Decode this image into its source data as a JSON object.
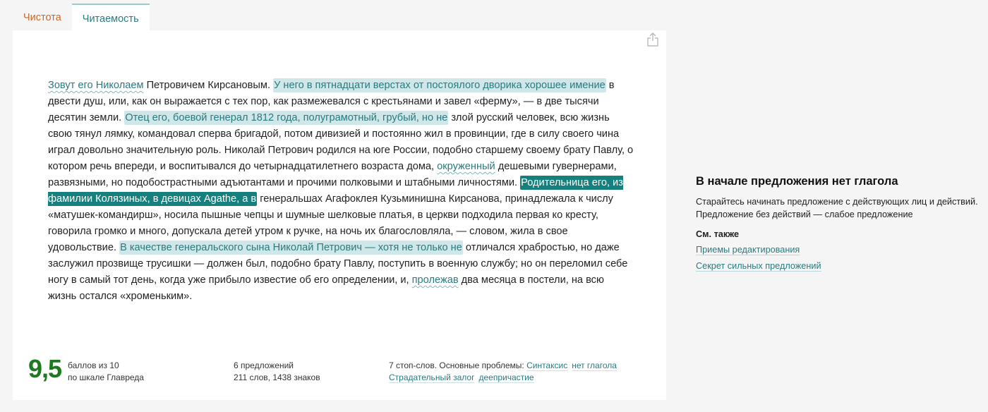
{
  "tabs": [
    {
      "label": "Чистота"
    },
    {
      "label": "Читаемость"
    }
  ],
  "text_segments": [
    "Зовут его Николаем",
    " Петровичем Кирсановым. ",
    "У него в пятнадцати верстах от постоялого дворика хорошее имение",
    " в двести душ, или, как он выражается с тех пор, как размежевался с крестьянами и завел «ферму», — в две тысячи десятин земли. ",
    "Отец его, боевой генерал 1812 года, полуграмотный, грубый, но не",
    " злой русский человек, всю жизнь свою тянул лямку, командовал сперва бригадой, потом дивизией и постоянно жил в провинции, где в силу своего чина играл довольно значительную роль. Николай Петрович родился на юге России, подобно старшему своему брату Павлу, о котором речь впереди, и воспитывался до четырнадцатилетнего возраста дома, ",
    "окруженный",
    " дешевыми гувернерами, развязными, но подобострастными адъютантами и прочими полковыми и штабными личностями. ",
    "Родительница его, из фамилии Колязиных, в девицах Agathe, а в",
    " генеральшах Агафоклея Кузьминишна Кирсанова, принадлежала к числу «матушек-командирш», носила пышные чепцы и шумные шелковые платья, в церкви подходила первая ко кресту, говорила громко и много, допускала детей утром к ручке, на ночь их благословляла, — словом, жила в свое удовольствие. ",
    "В качестве генеральского сына Николай Петрович — хотя не только не",
    " отличался храбростью, но даже заслужил прозвище трусишки — должен был, подобно брату Павлу, поступить в военную службу; но он переломил себе ногу в самый тот день, когда уже прибыло известие об его определении, и, ",
    "пролежав",
    " два месяца в постели, на всю жизнь остался «хроменьким»."
  ],
  "stats": {
    "score": "9,5",
    "score_line1": "баллов из 10",
    "score_line2": "по шкале Главреда",
    "sentences": "6 предложений",
    "words_chars": "211 слов, 1438 знаков",
    "stopwords": "7 стоп-слов. Основные проблемы:",
    "problems": [
      "Синтаксис",
      "нет глагола",
      "Страдательный залог",
      "деепричастие"
    ]
  },
  "side": {
    "title": "В начале предложения нет глагола",
    "desc": "Старайтесь начинать предложение с действующих лиц и действий. Предложение без действий — слабое предложение",
    "see_also": "См. также",
    "links": [
      "Приемы редактирования",
      "Секрет сильных предложений"
    ]
  },
  "colors": {
    "accent": "#2b7a80",
    "highlight": "#cfe7e8",
    "active_highlight": "#15807d",
    "score": "#1e7a1e",
    "tab_inactive": "#c8692a"
  }
}
